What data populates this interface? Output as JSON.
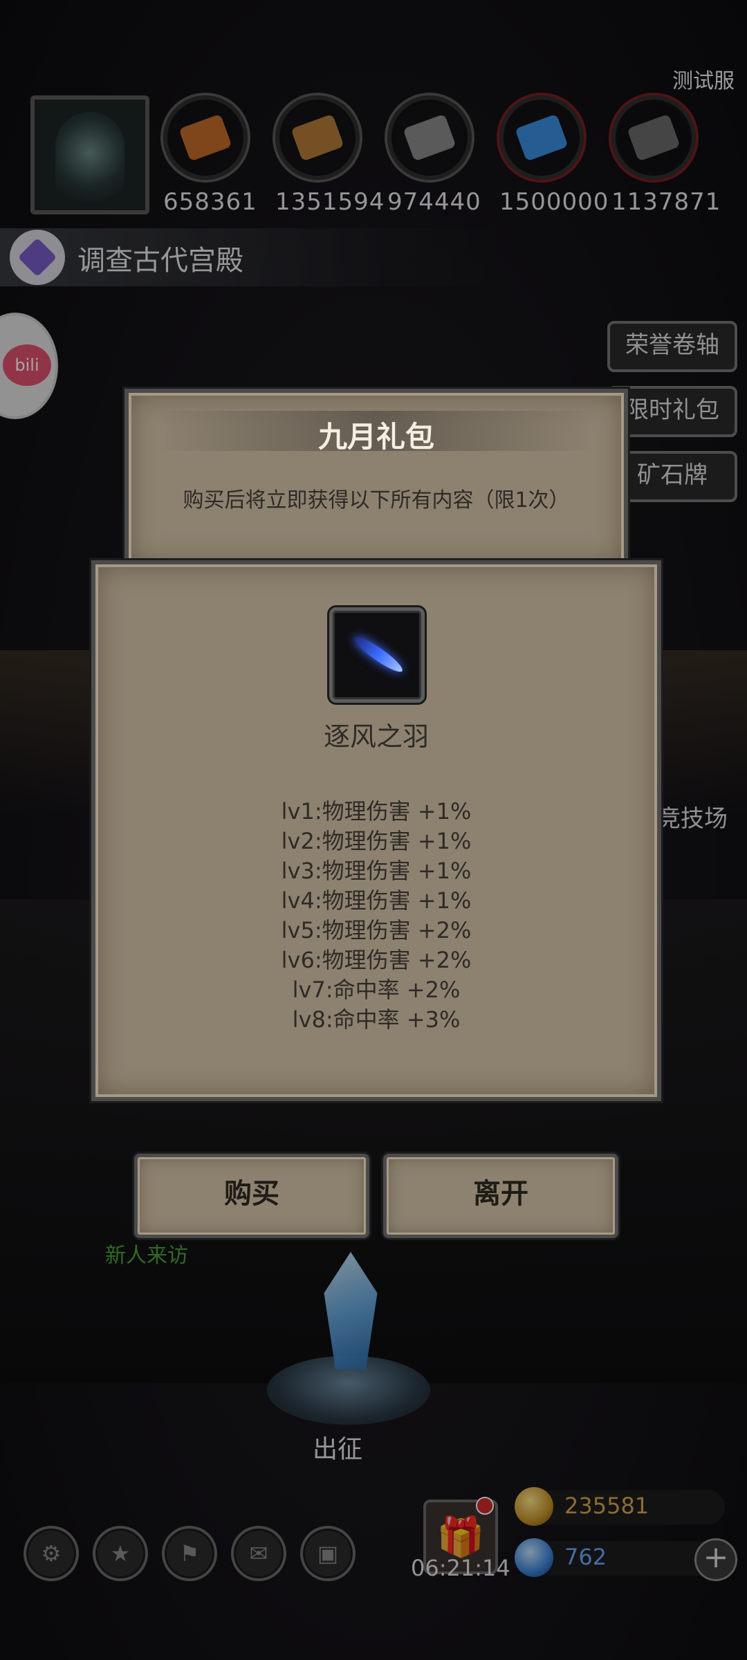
{
  "server_tag": "测试服",
  "resources": [
    {
      "icon": "wood-log-icon",
      "value": "658361",
      "color": "#c46a2a"
    },
    {
      "icon": "plank-icon",
      "value": "1351594",
      "color": "#b47b3a"
    },
    {
      "icon": "iron-ingot-icon",
      "value": "974440",
      "color": "#8a8a8a"
    },
    {
      "icon": "blue-crystal-icon",
      "value": "1500000",
      "color": "#3a8fe0"
    },
    {
      "icon": "dark-ore-icon",
      "value": "1137871",
      "color": "#6a6a6a"
    }
  ],
  "quest": {
    "text": "调查古代宫殿"
  },
  "bilibili": {
    "label": "bili"
  },
  "side_menu": [
    "荣誉卷轴",
    "限时礼包",
    "矿石牌"
  ],
  "gift_pack": {
    "title": "九月礼包",
    "subtitle": "购买后将立即获得以下所有内容（限1次）"
  },
  "item": {
    "name": "逐风之羽",
    "effects": [
      "lv1:物理伤害 +1%",
      "lv2:物理伤害 +1%",
      "lv3:物理伤害 +1%",
      "lv4:物理伤害 +1%",
      "lv5:物理伤害 +2%",
      "lv6:物理伤害 +2%",
      "lv7:命中率 +2%",
      "lv8:命中率 +3%"
    ]
  },
  "buttons": {
    "buy": "购买",
    "leave": "离开"
  },
  "scene": {
    "arena": "竞技场",
    "newcomer": "新人来访",
    "expedition": "出征"
  },
  "bottom_bar": {
    "icons": [
      "settings-gear-icon",
      "star-badge-icon",
      "banner-icon",
      "mail-icon",
      "chest-icon"
    ],
    "timer": "06:21:14",
    "gold": "235581",
    "gems": "762",
    "plus": "+"
  }
}
